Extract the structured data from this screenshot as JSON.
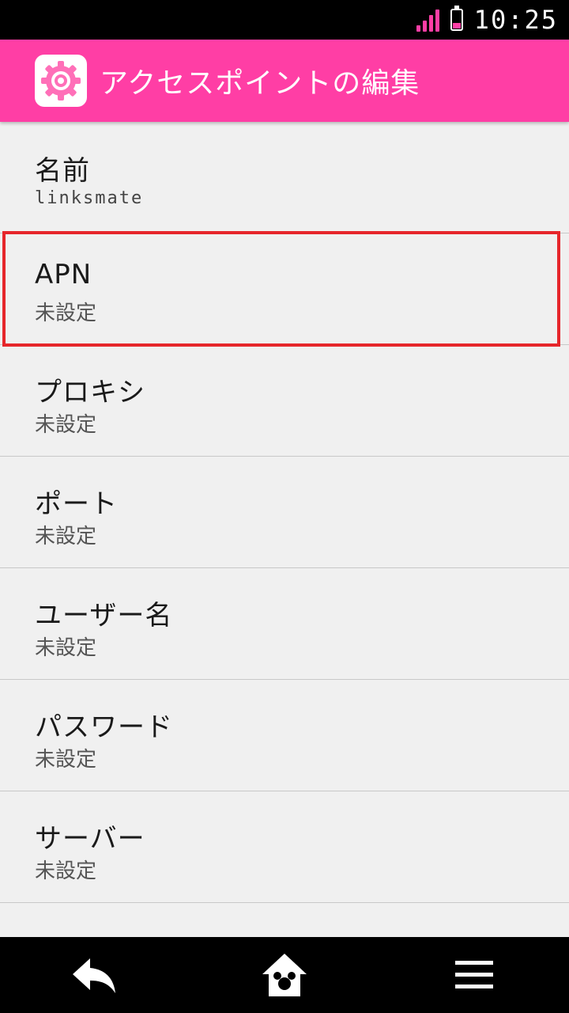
{
  "status_bar": {
    "time": "10:25",
    "signal_bars": 4,
    "battery_level": 0.3,
    "accent_color": "#ff3ea5"
  },
  "app_bar": {
    "title": "アクセスポイントの編集",
    "icon": "settings-gear-icon",
    "background_color": "#ff3ea5"
  },
  "settings": [
    {
      "title": "名前",
      "summary": "linksmate"
    },
    {
      "title": "APN",
      "summary": "未設定"
    },
    {
      "title": "プロキシ",
      "summary": "未設定"
    },
    {
      "title": "ポート",
      "summary": "未設定"
    },
    {
      "title": "ユーザー名",
      "summary": "未設定"
    },
    {
      "title": "パスワード",
      "summary": "未設定"
    },
    {
      "title": "サーバー",
      "summary": "未設定"
    }
  ],
  "highlight": {
    "color": "#e6262b",
    "target": "APN"
  },
  "nav_bar": {
    "back": "back-arrow-icon",
    "home": "home-mouse-icon",
    "menu": "menu-icon"
  }
}
